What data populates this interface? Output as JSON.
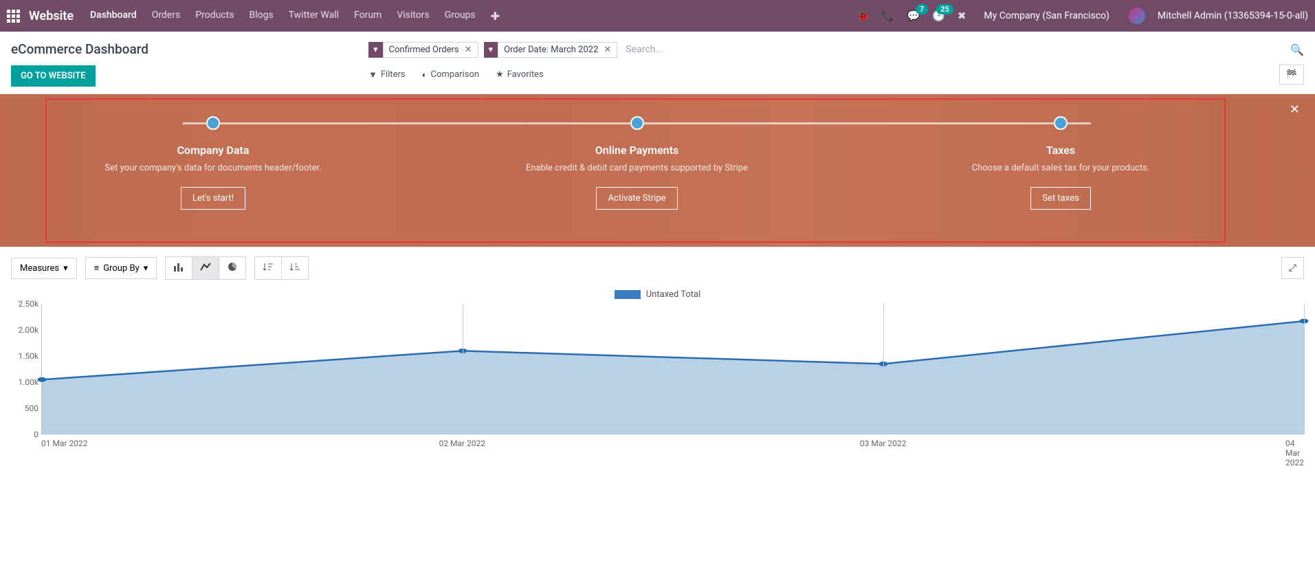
{
  "brand": "Website",
  "nav": [
    "Dashboard",
    "Orders",
    "Products",
    "Blogs",
    "Twitter Wall",
    "Forum",
    "Visitors",
    "Groups"
  ],
  "tray": {
    "chat_badge": "7",
    "activity_badge": "25",
    "company": "My Company (San Francisco)",
    "user": "Mitchell Admin (13365394-15-0-all)"
  },
  "page_title": "eCommerce Dashboard",
  "go_btn": "GO TO WEBSITE",
  "facets": [
    {
      "label": "Confirmed Orders"
    },
    {
      "label": "Order Date: March 2022"
    }
  ],
  "search_placeholder": "Search...",
  "toolbar": {
    "filters": "Filters",
    "comparison": "Comparison",
    "favorites": "Favorites"
  },
  "onboard": {
    "steps": [
      {
        "title": "Company Data",
        "desc": "Set your company's data for documents header/footer.",
        "btn": "Let's start!"
      },
      {
        "title": "Online Payments",
        "desc": "Enable credit & debit card payments supported by Stripe",
        "btn": "Activate Stripe"
      },
      {
        "title": "Taxes",
        "desc": "Choose a default sales tax for your products.",
        "btn": "Set taxes"
      }
    ]
  },
  "controls": {
    "measures": "Measures",
    "groupby": "Group By"
  },
  "legend": "Untaxed Total",
  "chart_data": {
    "type": "area",
    "series_name": "Untaxed Total",
    "categories": [
      "01 Mar 2022",
      "02 Mar 2022",
      "03 Mar 2022",
      "04 Mar 2022"
    ],
    "values": [
      1050,
      1600,
      1350,
      2170
    ],
    "ylim": [
      0,
      2500
    ],
    "yticks": [
      0,
      500,
      1000,
      1500,
      2000,
      2500
    ],
    "ytick_labels": [
      "0",
      "500",
      "1.00k",
      "1.50k",
      "2.00k",
      "2.50k"
    ]
  }
}
